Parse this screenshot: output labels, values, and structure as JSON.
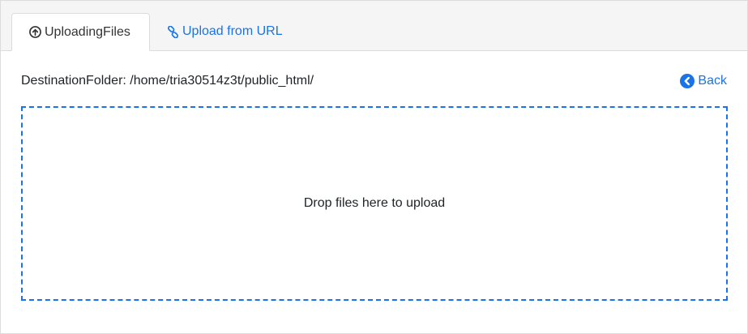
{
  "tabs": [
    {
      "label": "UploadingFiles",
      "icon": "upload-circle-icon",
      "active": true
    },
    {
      "label": "Upload from URL",
      "icon": "link-icon",
      "active": false
    }
  ],
  "destination": {
    "label": "DestinationFolder: /home/tria30514z3t/public_html/"
  },
  "back": {
    "label": "Back",
    "icon": "chevron-left-circle-icon"
  },
  "dropzone": {
    "text": "Drop files here to upload"
  },
  "colors": {
    "accent": "#1a73e8",
    "tabbar_bg": "#f5f5f5",
    "border": "#dcdcdc"
  }
}
